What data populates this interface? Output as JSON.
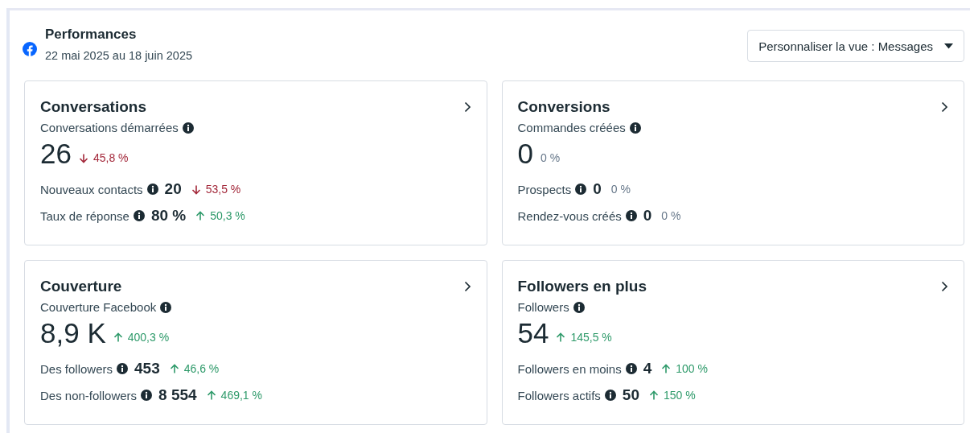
{
  "header": {
    "title": "Performances",
    "date_range": "22 mai 2025 au 18 juin 2025",
    "view_selector": "Personnaliser la vue : Messages"
  },
  "cards": [
    {
      "title": "Conversations",
      "metric": "Conversations démarrées",
      "value": "26",
      "change": "45,8 %",
      "kind": "down",
      "rows": [
        {
          "label": "Nouveaux contacts",
          "value": "20",
          "change": "53,5 %",
          "kind": "down"
        },
        {
          "label": "Taux de réponse",
          "value": "80 %",
          "change": "50,3 %",
          "kind": "up"
        }
      ]
    },
    {
      "title": "Conversions",
      "metric": "Commandes créées",
      "value": "0",
      "change": "0 %",
      "kind": "flat",
      "rows": [
        {
          "label": "Prospects",
          "value": "0",
          "change": "0 %",
          "kind": "flat"
        },
        {
          "label": "Rendez-vous créés",
          "value": "0",
          "change": "0 %",
          "kind": "flat"
        }
      ]
    },
    {
      "title": "Couverture",
      "metric": "Couverture Facebook",
      "value": "8,9 K",
      "change": "400,3 %",
      "kind": "up",
      "rows": [
        {
          "label": "Des followers",
          "value": "453",
          "change": "46,6 %",
          "kind": "up"
        },
        {
          "label": "Des non-followers",
          "value": "8 554",
          "change": "469,1 %",
          "kind": "up"
        }
      ]
    },
    {
      "title": "Followers en plus",
      "metric": "Followers",
      "value": "54",
      "change": "145,5 %",
      "kind": "up",
      "rows": [
        {
          "label": "Followers en moins",
          "value": "4",
          "change": "100 %",
          "kind": "up"
        },
        {
          "label": "Followers actifs",
          "value": "50",
          "change": "150 %",
          "kind": "up"
        }
      ]
    }
  ]
}
